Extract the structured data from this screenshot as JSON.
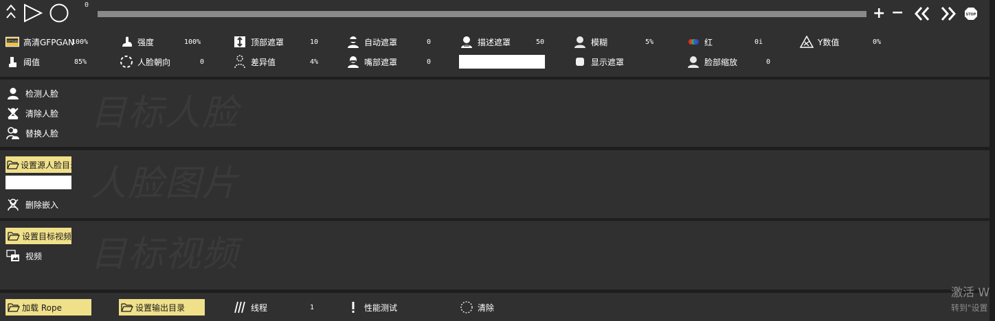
{
  "playback": {
    "frame": "0",
    "plus": "+",
    "minus": "−",
    "stop": "STOP"
  },
  "params": {
    "gfpgan": {
      "label": "高清GFPGAN",
      "value": "100%",
      "badge": "GFPGAN"
    },
    "strength": {
      "label": "强度",
      "value": "100%"
    },
    "top_mask": {
      "label": "顶部遮罩",
      "value": "10"
    },
    "auto_mask": {
      "label": "自动遮罩",
      "value": "0"
    },
    "desc_mask": {
      "label": "描述遮罩",
      "value": "50"
    },
    "blur": {
      "label": "模糊",
      "value": "5%"
    },
    "red": {
      "label": "红",
      "value": "0i"
    },
    "y_value": {
      "label": "Y数值",
      "value": "0%"
    },
    "threshold": {
      "label": "阈值",
      "value": "85%"
    },
    "face_orientation": {
      "label": "人脸朝向",
      "value": "0"
    },
    "diff": {
      "label": "差异值",
      "value": "4%"
    },
    "mouth_mask": {
      "label": "嘴部遮罩",
      "value": "0"
    },
    "show_mask": {
      "label": "显示遮罩"
    },
    "face_scale": {
      "label": "脸部缩放",
      "value": "0"
    }
  },
  "faces_panel": {
    "watermark": "目标人脸",
    "items": [
      {
        "label": "检测人脸"
      },
      {
        "label": "清除人脸"
      },
      {
        "label": "替换人脸"
      }
    ]
  },
  "source_panel": {
    "watermark": "人脸图片",
    "set_dir_label": "设置源人脸目录",
    "delete_embed_label": "删除嵌入"
  },
  "video_panel": {
    "watermark": "目标视频",
    "set_video_label": "设置目标视频",
    "video_label": "视频"
  },
  "bottom": {
    "load_rope": "加载 Rope",
    "set_output": "设置输出目录",
    "threads_label": "线程",
    "threads_value": "1",
    "perf_test": "性能测试",
    "clear": "清除"
  },
  "windows": {
    "activate": "激活 W",
    "goto_settings": "转到\"设置"
  },
  "colors": {
    "panel": "#303030",
    "background": "#1e1e1e",
    "button_yellow": "#f0e08a",
    "scrubber": "#8a8a8a"
  }
}
